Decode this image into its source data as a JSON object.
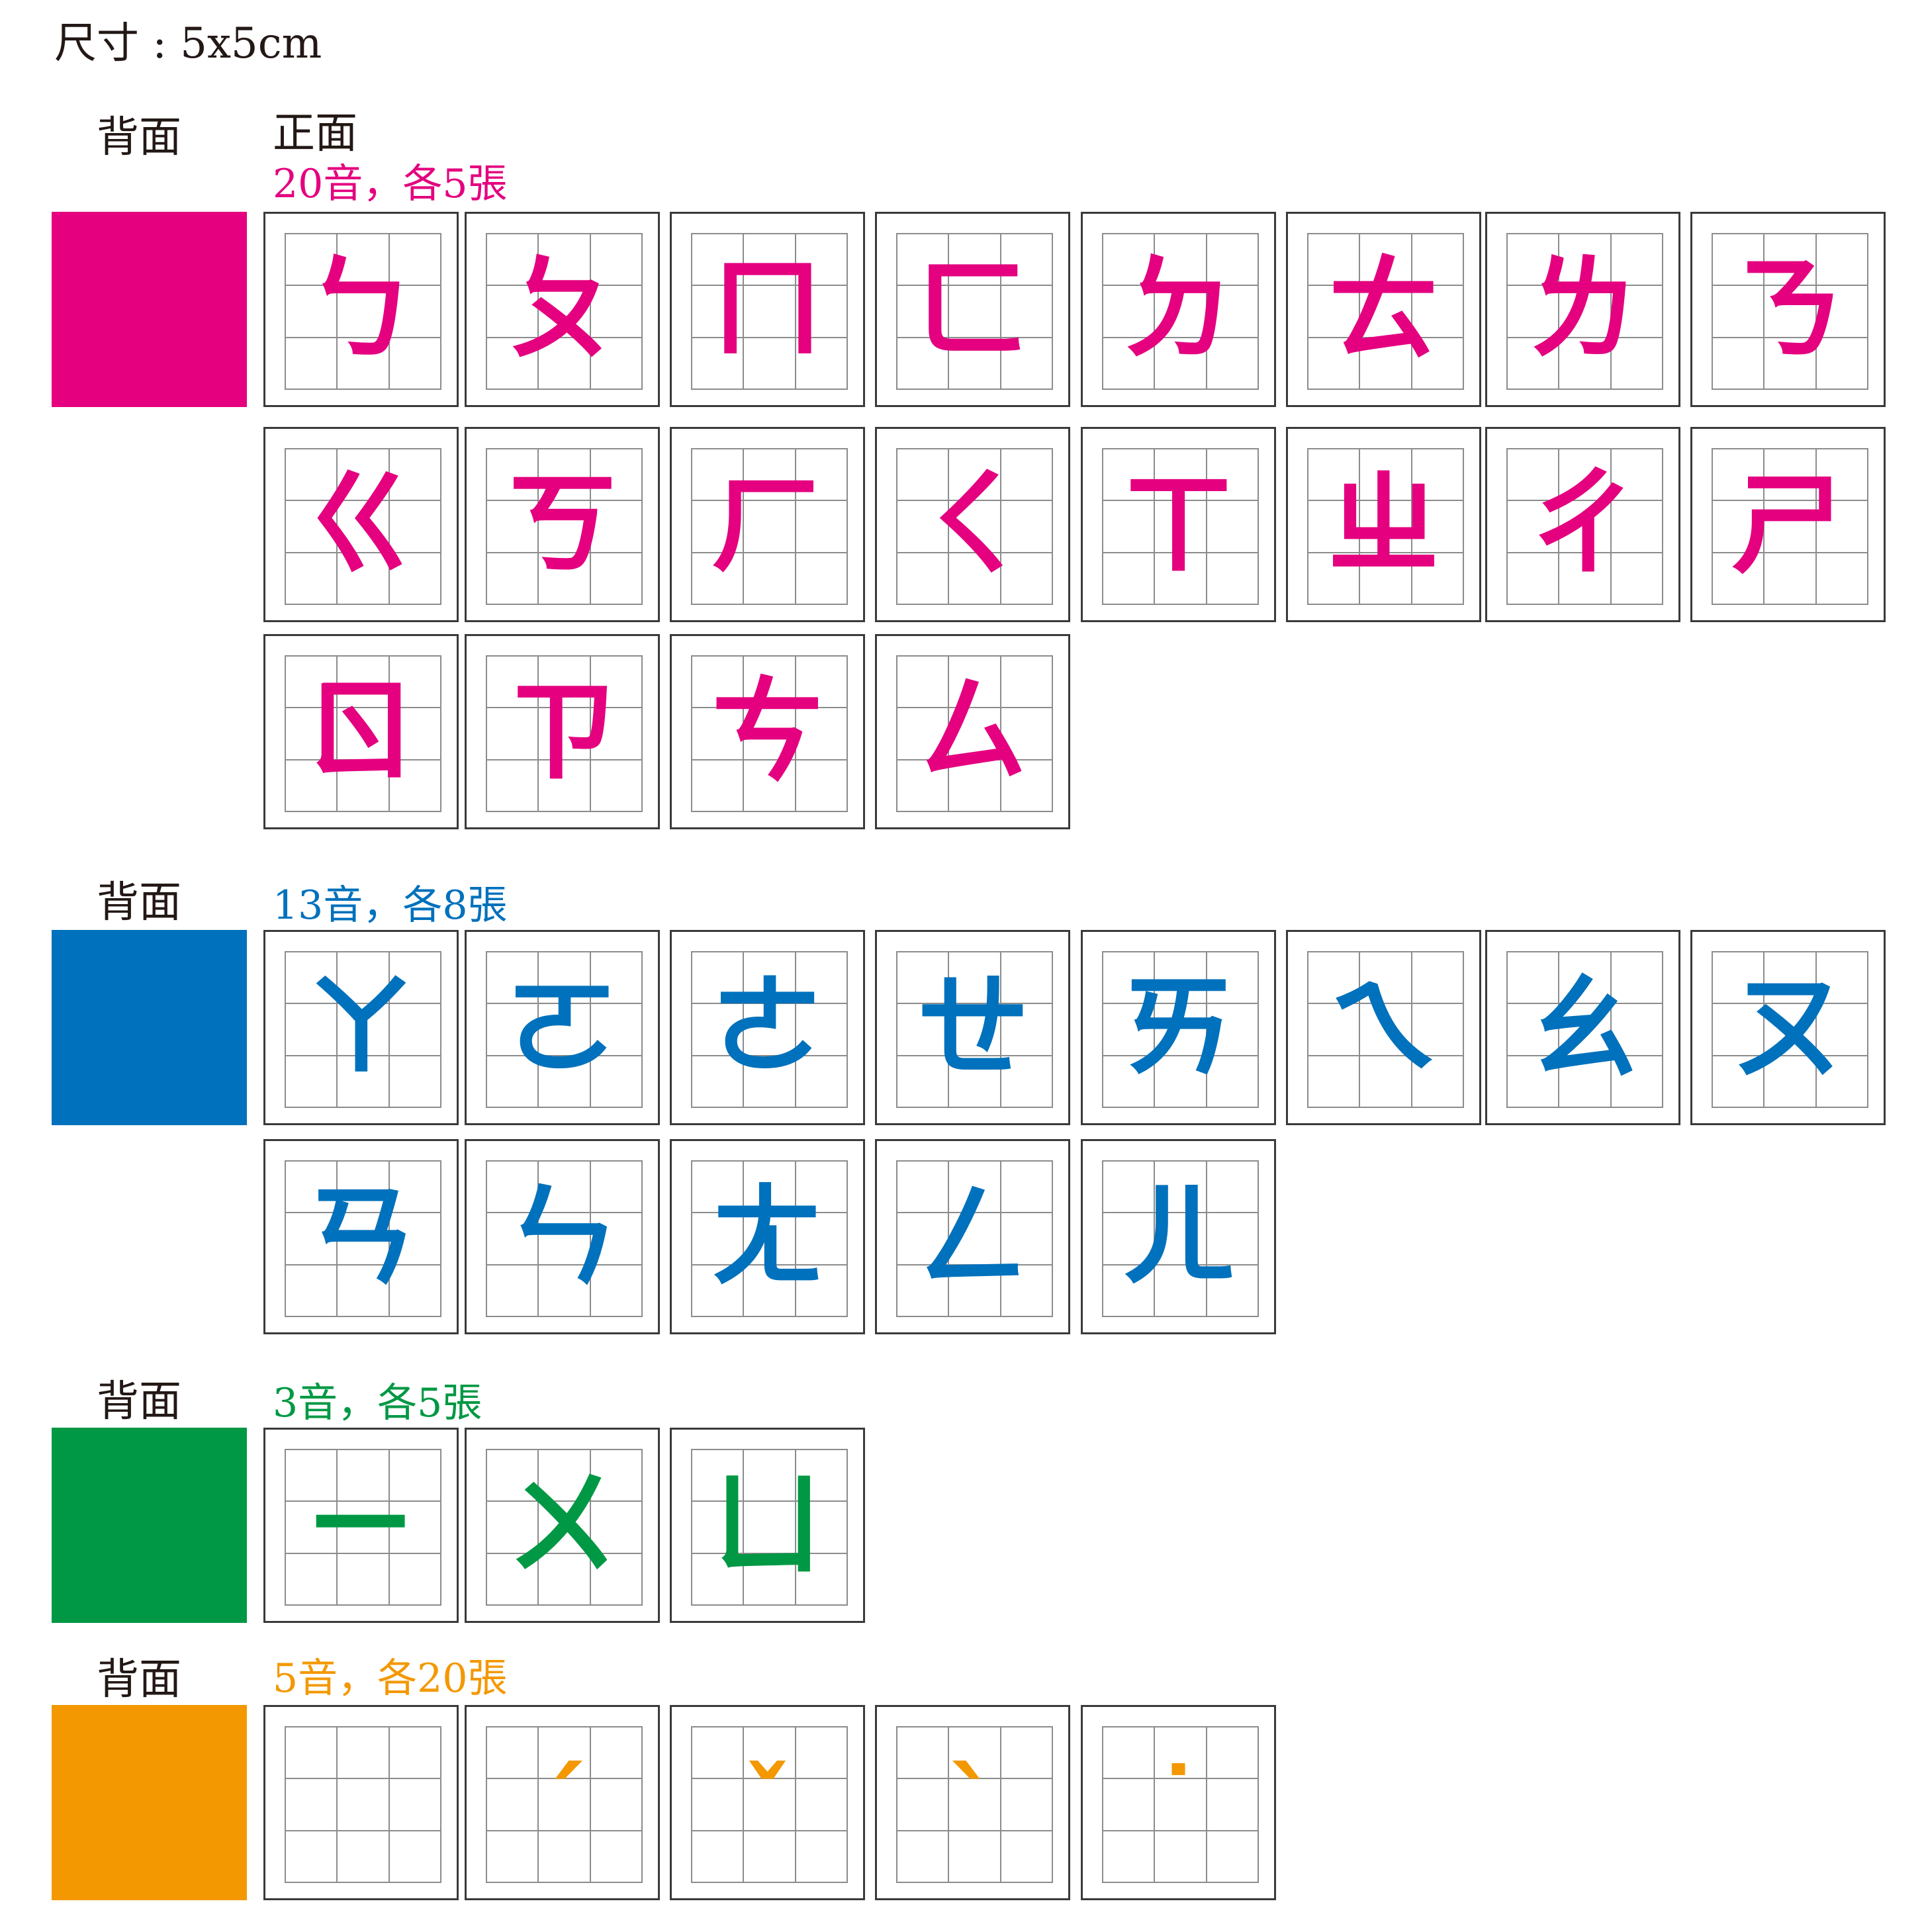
{
  "size_label": "尺寸 : 5x5cm",
  "back_label": "背面",
  "front_label": "正面",
  "groups": [
    {
      "color": "#E4007F",
      "count_label": "20音，各5張",
      "chars": [
        "ㄅ",
        "ㄆ",
        "ㄇ",
        "ㄈ",
        "ㄉ",
        "ㄊ",
        "ㄌ",
        "ㄋ",
        "ㄍ",
        "ㄎ",
        "ㄏ",
        "ㄑ",
        "ㄒ",
        "ㄓ",
        "ㄔ",
        "ㄕ",
        "ㄖ",
        "ㄗ",
        "ㄘ",
        "ㄙ"
      ]
    },
    {
      "color": "#0071BC",
      "count_label": "13音，各8張",
      "chars": [
        "ㄚ",
        "ㄛ",
        "ㄜ",
        "ㄝ",
        "ㄞ",
        "ㄟ",
        "ㄠ",
        "ㄡ",
        "ㄢ",
        "ㄣ",
        "ㄤ",
        "ㄥ",
        "ㄦ"
      ]
    },
    {
      "color": "#009844",
      "count_label": "3音，各5張",
      "chars": [
        "ㄧ",
        "ㄨ",
        "ㄩ"
      ]
    },
    {
      "color": "#F39800",
      "count_label": "5音，各20張",
      "chars": [
        "",
        "ˊ",
        "ˇ",
        "ˋ",
        "˙"
      ]
    }
  ]
}
